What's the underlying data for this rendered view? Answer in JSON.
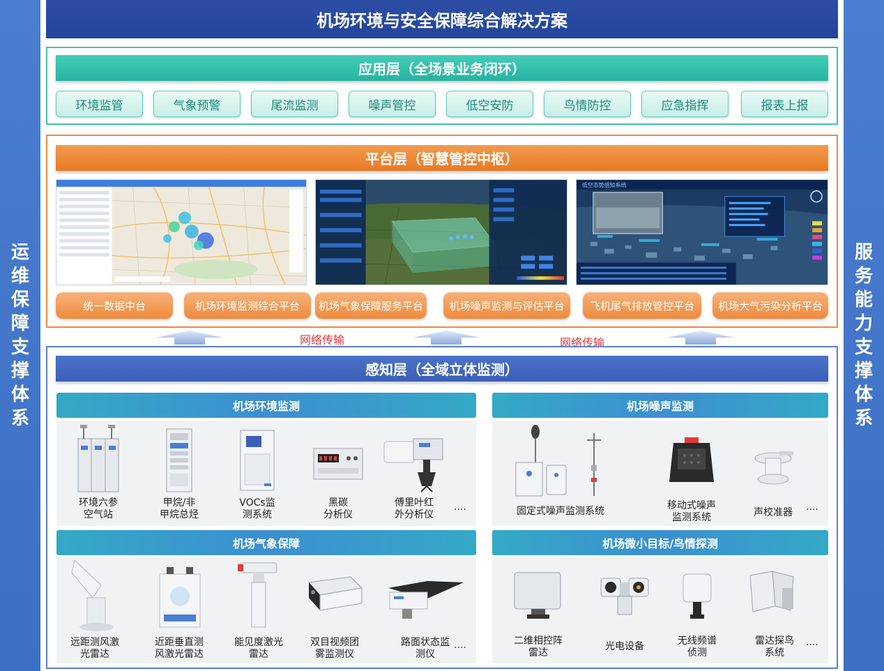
{
  "title": "机场环境与安全保障综合解决方案",
  "side_left": "运维保障支撑体系",
  "side_right": "服务能力支撑体系",
  "application_layer": {
    "title": "应用层（全场景业务闭环）",
    "items": [
      "环境监管",
      "气象预警",
      "尾流监测",
      "噪声管控",
      "低空安防",
      "鸟情防控",
      "应急指挥",
      "报表上报"
    ]
  },
  "platform_layer": {
    "title": "平台层（智慧管控中枢）",
    "items": [
      "统一数据中台",
      "机场环境监测综合平台",
      "机场气象保障服务平台",
      "机场噪声监测与评估平台",
      "飞机尾气排放管控平台",
      "机场大气污染分析平台"
    ],
    "screenshot3_title": "低空态势感知系统"
  },
  "network_label_1": "网络传输",
  "network_label_2": "网络传输",
  "perception_layer": {
    "title": "感知层（全域立体监测）",
    "env": {
      "title": "机场环境监测",
      "devices": [
        {
          "l1": "环境六参",
          "l2": "空气站"
        },
        {
          "l1": "甲烷/非",
          "l2": "甲烷总烃"
        },
        {
          "l1": "VOCs监",
          "l2": "测系统"
        },
        {
          "l1": "黑碳",
          "l2": "分析仪"
        },
        {
          "l1": "傅里叶红",
          "l2": "外分析仪"
        }
      ],
      "more": "...."
    },
    "noise": {
      "title": "机场噪声监测",
      "devices": [
        {
          "l1": "固定式噪声监测系统",
          "l2": ""
        },
        {
          "l1": "移动式噪声",
          "l2": "监测系统"
        },
        {
          "l1": "声校准器",
          "l2": ""
        }
      ],
      "more": "...."
    },
    "weather": {
      "title": "机场气象保障",
      "devices": [
        {
          "l1": "远距测风激",
          "l2": "光雷达"
        },
        {
          "l1": "近距垂直测",
          "l2": "风激光雷达"
        },
        {
          "l1": "能见度激光",
          "l2": "雷达"
        },
        {
          "l1": "双目视频团",
          "l2": "雾监测仪"
        },
        {
          "l1": "路面状态监",
          "l2": "测仪"
        }
      ],
      "more": "...."
    },
    "bird": {
      "title": "机场微小目标/鸟情探测",
      "devices": [
        {
          "l1": "二维相控阵",
          "l2": "雷达"
        },
        {
          "l1": "光电设备",
          "l2": ""
        },
        {
          "l1": "无线频谱",
          "l2": "侦测"
        },
        {
          "l1": "雷达探鸟",
          "l2": "系统"
        }
      ],
      "more": "...."
    }
  },
  "colors": {
    "title_bar": "#2a4ca3",
    "side_bar": "#4477cc",
    "app_accent": "#2fbfad",
    "platform_accent": "#ef8a3a",
    "perception_accent": "#3d63bb",
    "network_label": "#e03a3a"
  }
}
